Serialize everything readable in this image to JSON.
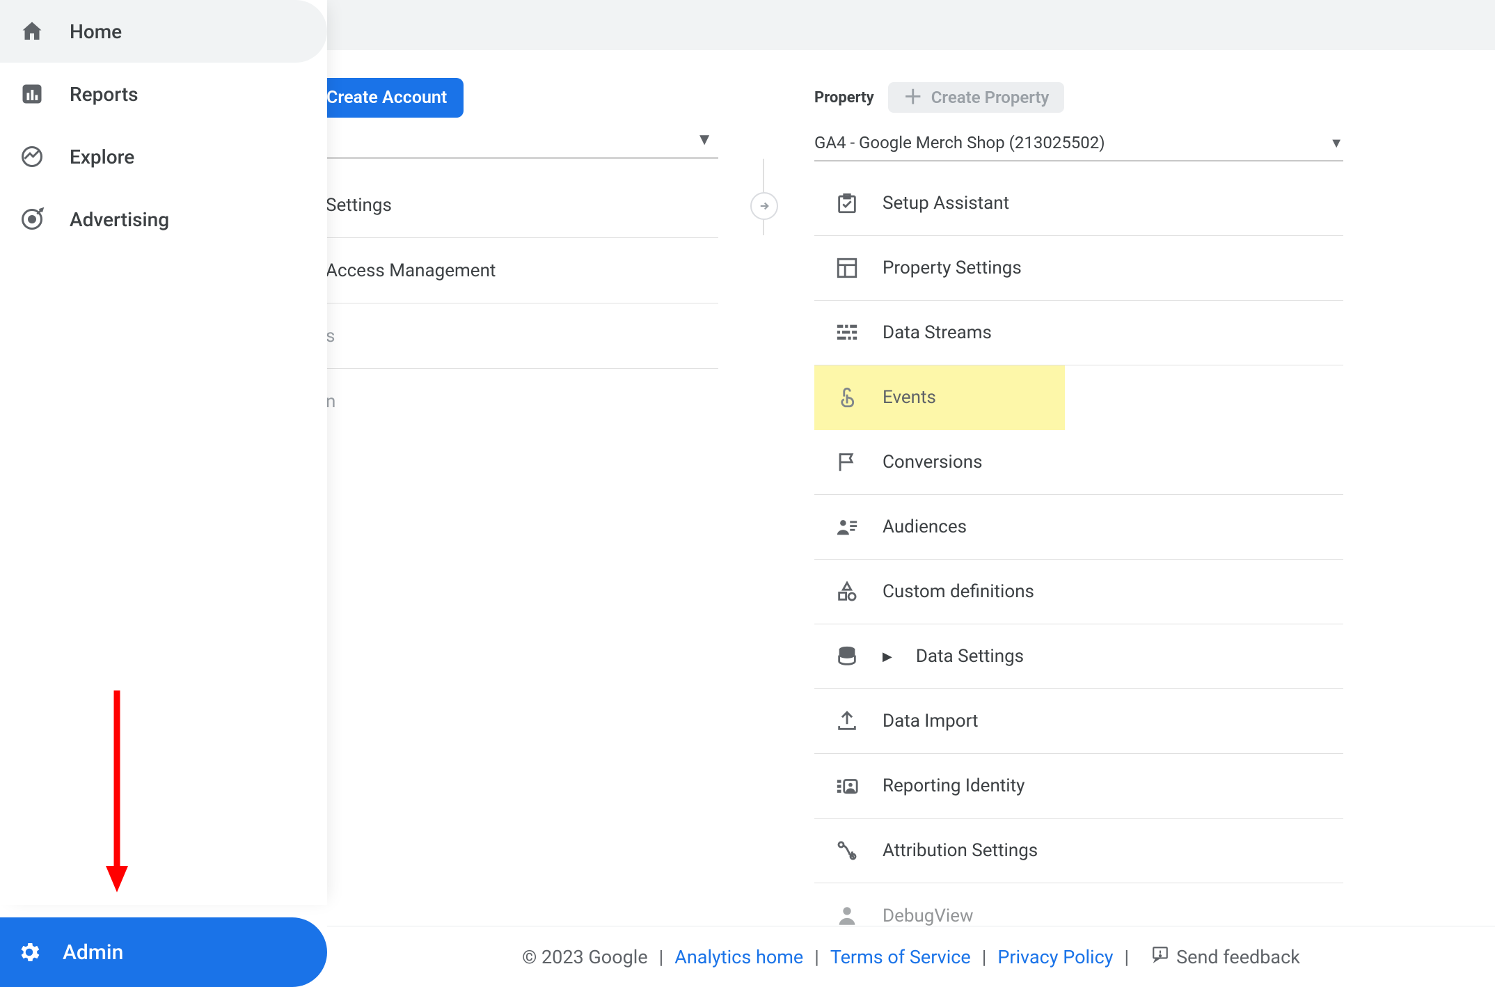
{
  "nav": {
    "items": [
      {
        "label": "Home"
      },
      {
        "label": "Reports"
      },
      {
        "label": "Explore"
      },
      {
        "label": "Advertising"
      }
    ],
    "admin": "Admin"
  },
  "account": {
    "create_button": "Create Account",
    "menu": [
      {
        "label": "Settings"
      },
      {
        "label": "Access Management"
      },
      {
        "label": "s"
      },
      {
        "label": "n"
      }
    ]
  },
  "property": {
    "header_label": "Property",
    "create_button": "Create Property",
    "selected": "GA4 - Google Merch Shop (213025502)",
    "menu": [
      {
        "label": "Setup Assistant"
      },
      {
        "label": "Property Settings"
      },
      {
        "label": "Data Streams"
      },
      {
        "label": "Events"
      },
      {
        "label": "Conversions"
      },
      {
        "label": "Audiences"
      },
      {
        "label": "Custom definitions"
      },
      {
        "label": "Data Settings",
        "expandable": true
      },
      {
        "label": "Data Import"
      },
      {
        "label": "Reporting Identity"
      },
      {
        "label": "Attribution Settings"
      },
      {
        "label": "DebugView"
      }
    ]
  },
  "footer": {
    "copyright": "© 2023 Google",
    "links": {
      "home": "Analytics home",
      "tos": "Terms of Service",
      "privacy": "Privacy Policy"
    },
    "feedback": "Send feedback"
  }
}
